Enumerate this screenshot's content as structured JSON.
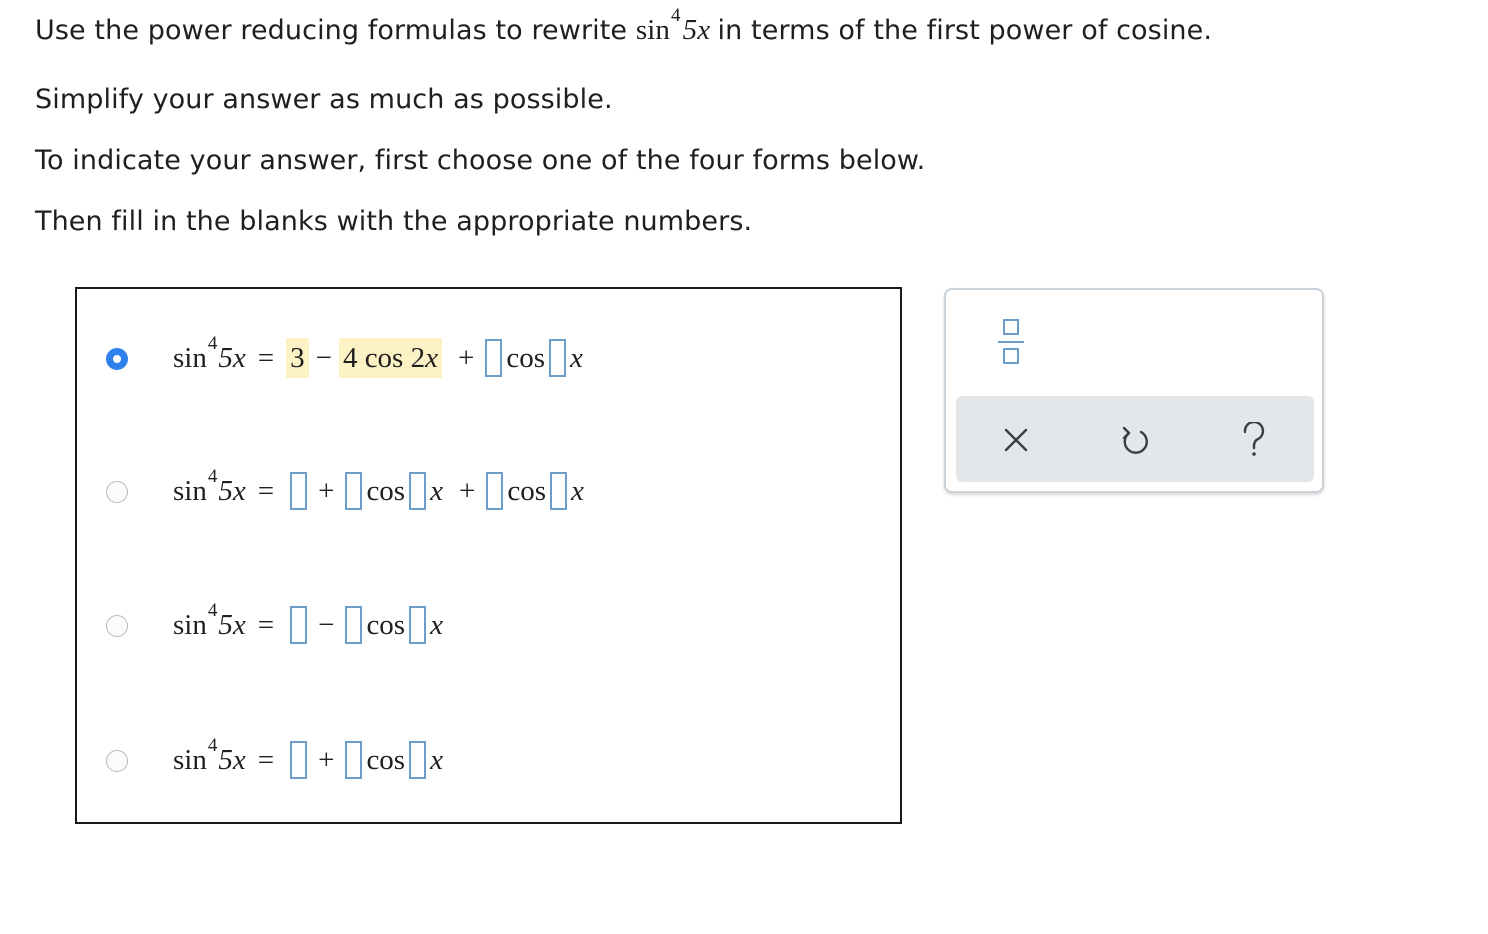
{
  "instructions": {
    "line1_before": "Use the power reducing formulas to rewrite",
    "line1_func": "sin",
    "line1_exp": "4",
    "line1_arg": "5x",
    "line1_after": "in terms of the first power of cosine.",
    "line2": "Simplify your answer as much as possible.",
    "line3": "To indicate your answer, first choose one of the four forms below.",
    "line4": "Then fill in the blanks with the appropriate numbers."
  },
  "math": {
    "sin": "sin",
    "exp": "4",
    "arg": "5x",
    "equals": "=",
    "plus": "+",
    "minus": "−",
    "cos": "cos",
    "x": "x"
  },
  "options": [
    {
      "selected": true,
      "filled_constant": "3",
      "filled_coefficient": "4 cos 2",
      "filled_var": "x"
    },
    {
      "selected": false
    },
    {
      "selected": false
    },
    {
      "selected": false
    }
  ],
  "tools": {
    "fraction": "fraction-icon",
    "clear": "close-icon",
    "undo": "undo-icon",
    "help": "help-icon",
    "accent_color": "#6c9ec9",
    "selected_radio_color": "#2f80ed"
  }
}
